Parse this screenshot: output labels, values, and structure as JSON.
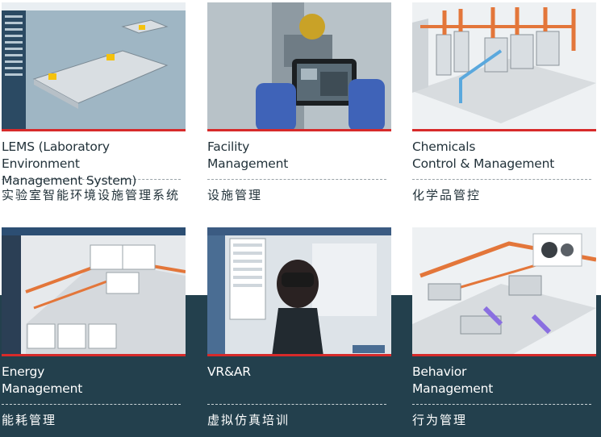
{
  "colors": {
    "band": "#23404d",
    "accent_line": "#d72a2a",
    "text_dark": "#22323a",
    "text_light": "#ffffff"
  },
  "cards": [
    {
      "title_line1": "LEMS (Laboratory Environment",
      "title_line2": "Management System)",
      "subtitle": "实验室智能环境设施管理系统",
      "image": "lems-3d-floorplan-screenshot"
    },
    {
      "title_line1": "Facility",
      "title_line2": "Management",
      "subtitle": "设施管理",
      "image": "tablet-inspection-photo"
    },
    {
      "title_line1": "Chemicals",
      "title_line2": "Control & Management",
      "subtitle": "化学品管控",
      "image": "chemical-storage-room-render"
    },
    {
      "title_line1": "Energy",
      "title_line2": "Management",
      "subtitle": "能耗管理",
      "image": "energy-dashboard-screenshot"
    },
    {
      "title_line1": "VR&AR",
      "title_line2": "",
      "subtitle": "虚拟仿真培训",
      "image": "vr-headset-training-photo"
    },
    {
      "title_line1": "Behavior",
      "title_line2": "Management",
      "subtitle": "行为管理",
      "image": "lab-ventilation-render"
    }
  ]
}
